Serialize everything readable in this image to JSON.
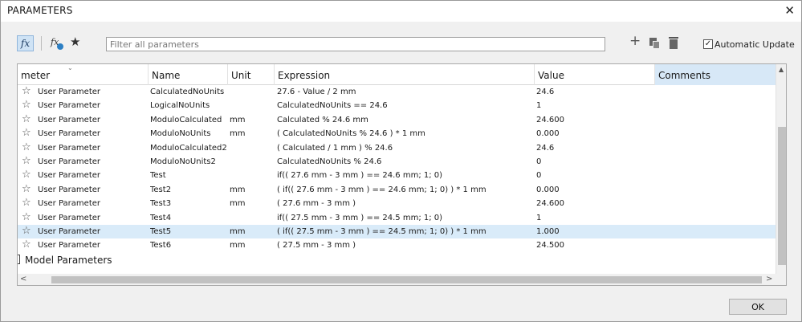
{
  "window": {
    "title": "PARAMETERS",
    "close_glyph": "✕"
  },
  "toolbar": {
    "fx_label": "fx",
    "user_fx_label": "fx",
    "star_glyph": "★",
    "filter_placeholder": "Filter all parameters",
    "add_glyph": "+",
    "auto_update_label": "Automatic Update",
    "auto_update_checked": true,
    "check_glyph": "✓"
  },
  "table": {
    "columns": {
      "parameter": "meter",
      "name": "Name",
      "unit": "Unit",
      "expression": "Expression",
      "value": "Value",
      "comments": "Comments"
    },
    "sort_caret": "⌄",
    "rows": [
      {
        "type": "User Parameter",
        "name": "CalculatedNoUnits",
        "unit": "",
        "expression": "27.6 - Value / 2 mm",
        "value": "24.6"
      },
      {
        "type": "User Parameter",
        "name": "LogicalNoUnits",
        "unit": "",
        "expression": "CalculatedNoUnits == 24.6",
        "value": "1"
      },
      {
        "type": "User Parameter",
        "name": "ModuloCalculated",
        "unit": "mm",
        "expression": "Calculated % 24.6 mm",
        "value": "24.600"
      },
      {
        "type": "User Parameter",
        "name": "ModuloNoUnits",
        "unit": "mm",
        "expression": "( CalculatedNoUnits % 24.6 ) * 1 mm",
        "value": "0.000"
      },
      {
        "type": "User Parameter",
        "name": "ModuloCalculated2",
        "unit": "",
        "expression": "( Calculated / 1 mm ) % 24.6",
        "value": "24.6"
      },
      {
        "type": "User Parameter",
        "name": "ModuloNoUnits2",
        "unit": "",
        "expression": "CalculatedNoUnits % 24.6",
        "value": "0"
      },
      {
        "type": "User Parameter",
        "name": "Test",
        "unit": "",
        "expression": "if(( 27.6 mm - 3 mm ) == 24.6 mm; 1; 0)",
        "value": "0"
      },
      {
        "type": "User Parameter",
        "name": "Test2",
        "unit": "mm",
        "expression": "( if(( 27.6 mm - 3 mm ) == 24.6 mm; 1; 0) ) * 1 mm",
        "value": "0.000"
      },
      {
        "type": "User Parameter",
        "name": "Test3",
        "unit": "mm",
        "expression": "( 27.6 mm - 3 mm )",
        "value": "24.600"
      },
      {
        "type": "User Parameter",
        "name": "Test4",
        "unit": "",
        "expression": "if(( 27.5 mm - 3 mm ) == 24.5 mm; 1; 0)",
        "value": "1"
      },
      {
        "type": "User Parameter",
        "name": "Test5",
        "unit": "mm",
        "expression": "( if(( 27.5 mm - 3 mm ) == 24.5 mm; 1; 0) ) * 1 mm",
        "value": "1.000"
      },
      {
        "type": "User Parameter",
        "name": "Test6",
        "unit": "mm",
        "expression": "( 27.5 mm - 3 mm )",
        "value": "24.500"
      }
    ],
    "selected_row_index": 10,
    "row_star_glyph": "☆",
    "group_label": "Model Parameters"
  },
  "scrollbars": {
    "up_glyph": "▲",
    "left_glyph": "<",
    "right_glyph": ">"
  },
  "footer": {
    "ok_label": "OK"
  },
  "colors": {
    "selection": "#d9ebf9",
    "comments_header": "#d7e8f7",
    "fx_active": "#cfe3f5"
  }
}
